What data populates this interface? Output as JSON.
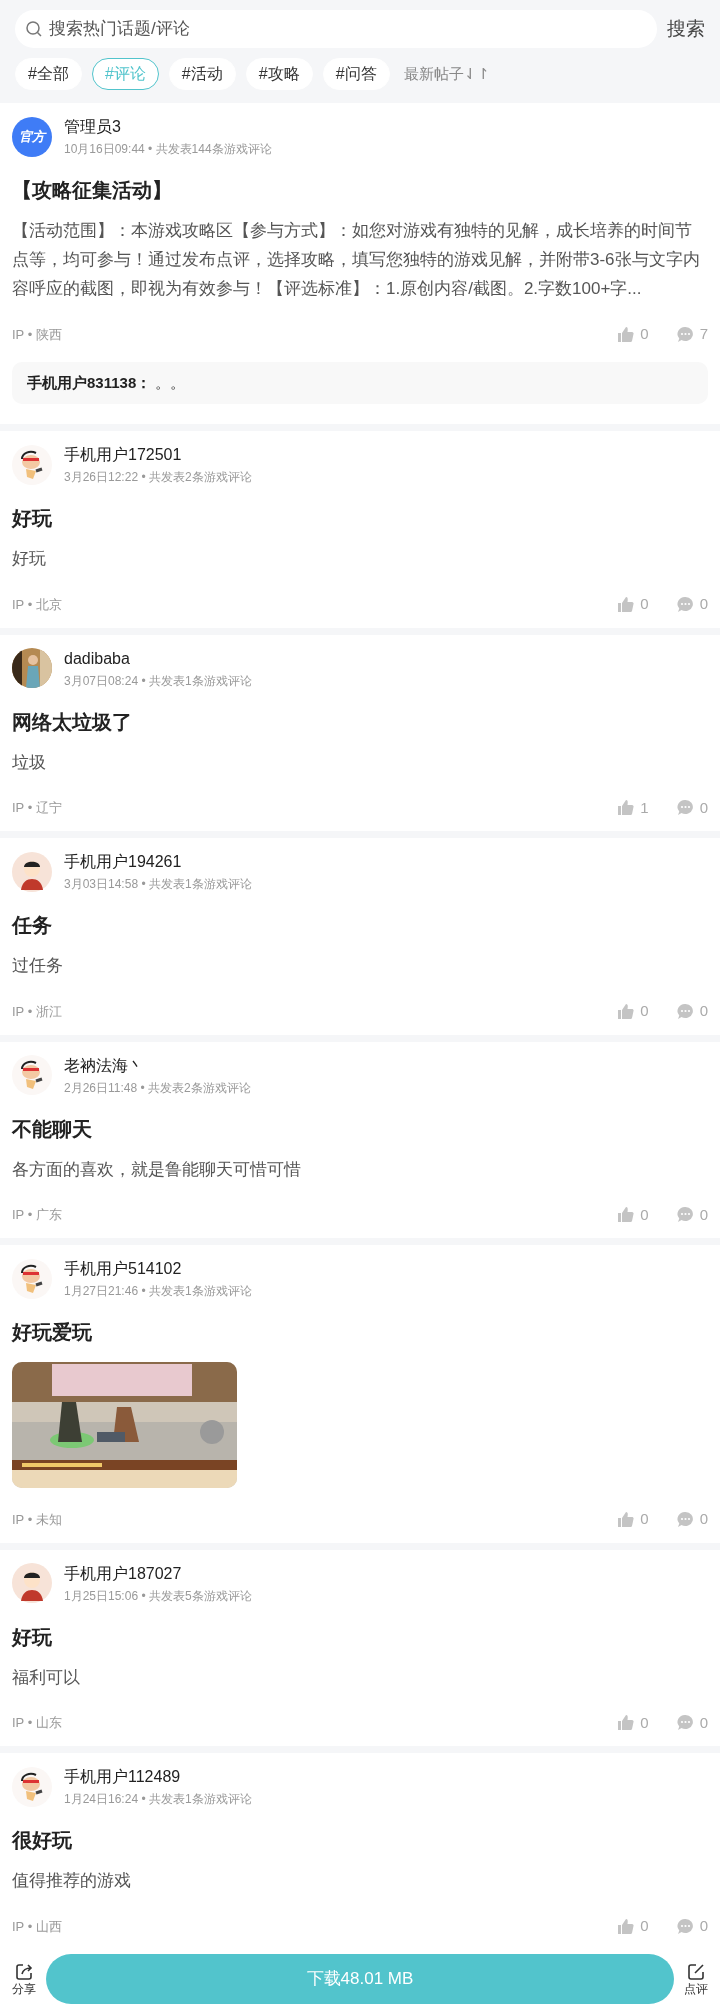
{
  "search": {
    "placeholder": "搜索热门话题/评论",
    "button": "搜索"
  },
  "tags": [
    {
      "label": "#全部",
      "selected": false
    },
    {
      "label": "#评论",
      "selected": true
    },
    {
      "label": "#活动",
      "selected": false
    },
    {
      "label": "#攻略",
      "selected": false
    },
    {
      "label": "#问答",
      "selected": false
    }
  ],
  "sort": {
    "label": "最新帖子",
    "icon": "⇃↾"
  },
  "posts": [
    {
      "avatar": {
        "kind": "official",
        "label": "官方"
      },
      "user": "管理员3",
      "meta": "10月16日09:44 • 共发表144条游戏评论",
      "title": "【攻略征集活动】",
      "body": "【活动范围】：本游戏攻略区【参与方式】：如您对游戏有独特的见解，成长培养的时间节点等，均可参与！通过发布点评，选择攻略，填写您独特的游戏见解，并附带3-6张与文字内容呼应的截图，即视为有效参与！【评选标准】：1.原创内容/截图。2.字数100+字...",
      "ip": "IP • 陕西",
      "likes": "0",
      "comments": "7",
      "reply": {
        "user": "手机用户831138：",
        "text": "。。"
      }
    },
    {
      "avatar": {
        "kind": "cartoon"
      },
      "user": "手机用户172501",
      "meta": "3月26日12:22 • 共发表2条游戏评论",
      "title": "好玩",
      "body": "好玩",
      "ip": "IP • 北京",
      "likes": "0",
      "comments": "0"
    },
    {
      "user": "dadibaba",
      "meta": "3月07日08:24 • 共发表1条游戏评论",
      "title": "网络太垃圾了",
      "body": "垃圾",
      "ip": "IP • 辽宁",
      "likes": "1",
      "comments": "0"
    },
    {
      "avatar": {
        "kind": "boy"
      },
      "user": "手机用户194261",
      "meta": "3月03日14:58 • 共发表1条游戏评论",
      "title": "任务",
      "body": "过任务",
      "ip": "IP • 浙江",
      "likes": "0",
      "comments": "0"
    },
    {
      "avatar": {
        "kind": "cartoon"
      },
      "user": "老衲法海丶",
      "meta": "2月26日11:48 • 共发表2条游戏评论",
      "title": "不能聊天",
      "body": "各方面的喜欢，就是鲁能聊天可惜可惜",
      "ip": "IP • 广东",
      "likes": "0",
      "comments": "0"
    },
    {
      "avatar": {
        "kind": "cartoon"
      },
      "user": "手机用户514102",
      "meta": "1月27日21:46 • 共发表1条游戏评论",
      "title": "好玩爱玩",
      "ip": "IP • 未知",
      "likes": "0",
      "comments": "0"
    },
    {
      "avatar": {
        "kind": "boy"
      },
      "user": "手机用户187027",
      "meta": "1月25日15:06 • 共发表5条游戏评论",
      "title": "好玩",
      "body": "福利可以",
      "ip": "IP • 山东",
      "likes": "0",
      "comments": "0"
    },
    {
      "avatar": {
        "kind": "cartoon"
      },
      "user": "手机用户112489",
      "meta": "1月24日16:24 • 共发表1条游戏评论",
      "title": "很好玩",
      "body": "值得推荐的游戏",
      "ip": "IP • 山西",
      "likes": "0",
      "comments": "0"
    }
  ],
  "bottom_bar": {
    "share": "分享",
    "download": "下载48.01 MB",
    "review": "点评"
  }
}
